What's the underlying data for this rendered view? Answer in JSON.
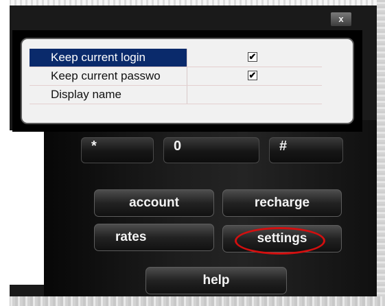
{
  "window": {
    "close_label": "x"
  },
  "settings_panel": {
    "rows": [
      {
        "label": "Keep current login",
        "checked": true,
        "check_glyph": "✔"
      },
      {
        "label": "Keep current passwo",
        "checked": true,
        "check_glyph": "✔"
      },
      {
        "label": "Display name",
        "checked": false,
        "check_glyph": ""
      }
    ]
  },
  "dialpad": {
    "keys": [
      "*",
      "0",
      "#"
    ]
  },
  "actions": {
    "account": "account",
    "recharge": "recharge",
    "rates": "rates",
    "settings": "settings",
    "help": "help"
  },
  "colors": {
    "selection": "#0a2a6b",
    "highlight_ring": "#d30f0f"
  }
}
